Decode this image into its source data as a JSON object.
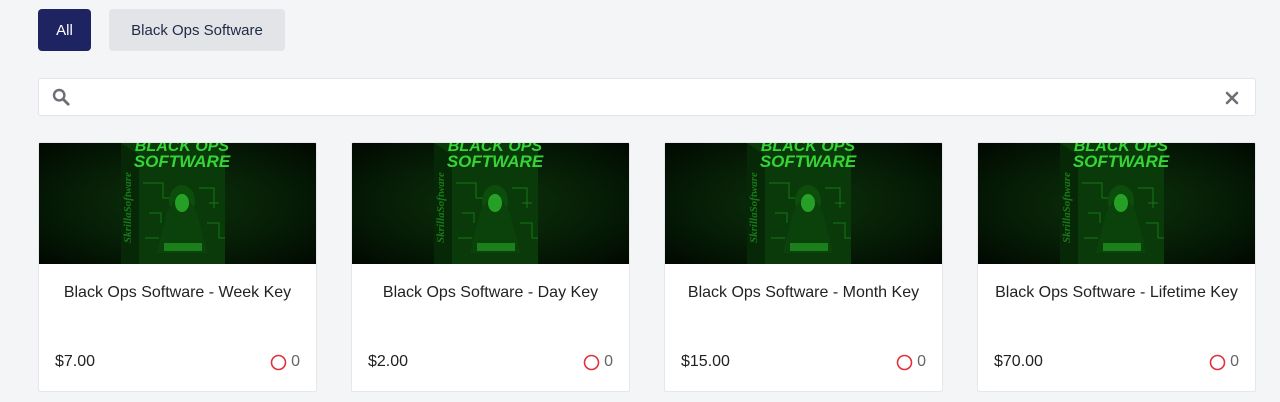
{
  "filters": [
    {
      "label": "All",
      "active": true
    },
    {
      "label": "Black Ops Software",
      "active": false
    }
  ],
  "search": {
    "placeholder": "",
    "value": ""
  },
  "products": [
    {
      "title": "Black Ops Software - Week Key",
      "price": "$7.00",
      "likes": "0",
      "cover_text": "SOFTWARE",
      "cover_side": "SkrillaSoftware"
    },
    {
      "title": "Black Ops Software - Day Key",
      "price": "$2.00",
      "likes": "0",
      "cover_text": "SOFTWARE",
      "cover_side": "SkrillaSoftware"
    },
    {
      "title": "Black Ops Software - Month Key",
      "price": "$15.00",
      "likes": "0",
      "cover_text": "SOFTWARE",
      "cover_side": "SkrillaSoftware"
    },
    {
      "title": "Black Ops Software - Lifetime Key",
      "price": "$70.00",
      "likes": "0",
      "cover_text": "SOFTWARE",
      "cover_side": "SkrillaSoftware"
    }
  ],
  "colors": {
    "accent": "#1e2461",
    "like": "#e0303a",
    "cover_green": "#2bd42b"
  },
  "icons": {
    "search": "search-icon",
    "clear": "close-icon",
    "like": "heart-outline-icon"
  }
}
